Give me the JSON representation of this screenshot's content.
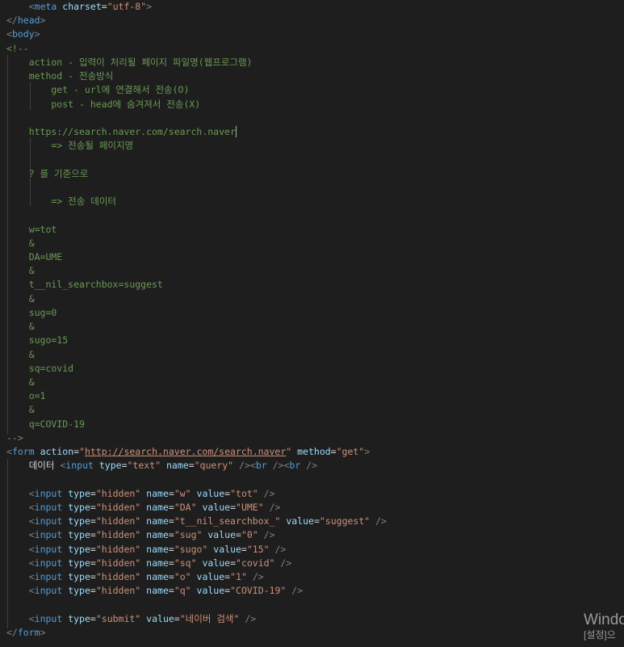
{
  "editor": {
    "language": "html",
    "colors": {
      "background": "#1e1e1e",
      "tag_bracket": "#808080",
      "tag_name": "#569cd6",
      "attribute": "#9cdcfe",
      "string": "#ce9178",
      "comment": "#6a9955",
      "text": "#d4d4d4"
    },
    "lines": [
      [
        {
          "t": "    "
        },
        {
          "c": "tag",
          "t": "<"
        },
        {
          "c": "tname",
          "t": "meta"
        },
        {
          "t": " "
        },
        {
          "c": "attr",
          "t": "charset"
        },
        {
          "t": "="
        },
        {
          "c": "str",
          "t": "\"utf-8\""
        },
        {
          "c": "tag",
          "t": ">"
        }
      ],
      [
        {
          "c": "tag",
          "t": "</"
        },
        {
          "c": "tname",
          "t": "head"
        },
        {
          "c": "tag",
          "t": ">"
        }
      ],
      [
        {
          "c": "tag",
          "t": "<"
        },
        {
          "c": "tname",
          "t": "body"
        },
        {
          "c": "tag",
          "t": ">"
        }
      ],
      [
        {
          "c": "cmt",
          "t": "<!--"
        }
      ],
      [
        {
          "c": "cmt",
          "t": "    action - 입력이 처리될 페이지 파일명(웹프로그램)"
        }
      ],
      [
        {
          "c": "cmt",
          "t": "    method - 전송방식"
        }
      ],
      [
        {
          "c": "cmt",
          "t": "        get - url에 연결해서 전송(O)"
        }
      ],
      [
        {
          "c": "cmt",
          "t": "        post - head에 숨겨져서 전송(X)"
        }
      ],
      [
        {
          "c": "cmt",
          "t": ""
        }
      ],
      [
        {
          "c": "cmt",
          "t": "    https://search.naver.com/search.naver"
        },
        {
          "cursor": true
        }
      ],
      [
        {
          "c": "cmt",
          "t": "        => 전송될 페이지명"
        }
      ],
      [
        {
          "c": "cmt",
          "t": ""
        }
      ],
      [
        {
          "c": "cmt",
          "t": "    ? 를 기준으로"
        }
      ],
      [
        {
          "c": "cmt",
          "t": ""
        }
      ],
      [
        {
          "c": "cmt",
          "t": "        => 전송 데이터"
        }
      ],
      [
        {
          "c": "cmt",
          "t": ""
        }
      ],
      [
        {
          "c": "cmt",
          "t": "    w=tot"
        }
      ],
      [
        {
          "c": "cmt",
          "t": "    &"
        }
      ],
      [
        {
          "c": "cmt",
          "t": "    DA=UME"
        }
      ],
      [
        {
          "c": "cmt",
          "t": "    &"
        }
      ],
      [
        {
          "c": "cmt",
          "t": "    t__nil_searchbox=suggest"
        }
      ],
      [
        {
          "c": "cmt",
          "t": "    &"
        }
      ],
      [
        {
          "c": "cmt",
          "t": "    sug=0"
        }
      ],
      [
        {
          "c": "cmt",
          "t": "    &"
        }
      ],
      [
        {
          "c": "cmt",
          "t": "    sugo=15"
        }
      ],
      [
        {
          "c": "cmt",
          "t": "    &"
        }
      ],
      [
        {
          "c": "cmt",
          "t": "    sq=covid"
        }
      ],
      [
        {
          "c": "cmt",
          "t": "    &"
        }
      ],
      [
        {
          "c": "cmt",
          "t": "    o=1"
        }
      ],
      [
        {
          "c": "cmt",
          "t": "    &"
        }
      ],
      [
        {
          "c": "cmt",
          "t": "    q=COVID-19"
        }
      ],
      [
        {
          "c": "cmt",
          "t": "-->"
        }
      ],
      [
        {
          "c": "tag",
          "t": "<"
        },
        {
          "c": "tname",
          "t": "form"
        },
        {
          "t": " "
        },
        {
          "c": "attr",
          "t": "action"
        },
        {
          "t": "="
        },
        {
          "c": "str",
          "t": "\""
        },
        {
          "c": "str url",
          "t": "http://search.naver.com/search.naver"
        },
        {
          "c": "str",
          "t": "\""
        },
        {
          "t": " "
        },
        {
          "c": "attr",
          "t": "method"
        },
        {
          "t": "="
        },
        {
          "c": "str",
          "t": "\"get\""
        },
        {
          "c": "tag",
          "t": ">"
        }
      ],
      [
        {
          "t": "    데이터 "
        },
        {
          "c": "tag",
          "t": "<"
        },
        {
          "c": "tname",
          "t": "input"
        },
        {
          "t": " "
        },
        {
          "c": "attr",
          "t": "type"
        },
        {
          "t": "="
        },
        {
          "c": "str",
          "t": "\"text\""
        },
        {
          "t": " "
        },
        {
          "c": "attr",
          "t": "name"
        },
        {
          "t": "="
        },
        {
          "c": "str",
          "t": "\"query\""
        },
        {
          "t": " "
        },
        {
          "c": "tag",
          "t": "/><"
        },
        {
          "c": "tname",
          "t": "br"
        },
        {
          "t": " "
        },
        {
          "c": "tag",
          "t": "/><"
        },
        {
          "c": "tname",
          "t": "br"
        },
        {
          "t": " "
        },
        {
          "c": "tag",
          "t": "/>"
        }
      ],
      [
        {
          "t": ""
        }
      ],
      [
        {
          "t": "    "
        },
        {
          "c": "tag",
          "t": "<"
        },
        {
          "c": "tname",
          "t": "input"
        },
        {
          "t": " "
        },
        {
          "c": "attr",
          "t": "type"
        },
        {
          "t": "="
        },
        {
          "c": "str",
          "t": "\"hidden\""
        },
        {
          "t": " "
        },
        {
          "c": "attr",
          "t": "name"
        },
        {
          "t": "="
        },
        {
          "c": "str",
          "t": "\"w\""
        },
        {
          "t": " "
        },
        {
          "c": "attr",
          "t": "value"
        },
        {
          "t": "="
        },
        {
          "c": "str",
          "t": "\"tot\""
        },
        {
          "t": " "
        },
        {
          "c": "tag",
          "t": "/>"
        }
      ],
      [
        {
          "t": "    "
        },
        {
          "c": "tag",
          "t": "<"
        },
        {
          "c": "tname",
          "t": "input"
        },
        {
          "t": " "
        },
        {
          "c": "attr",
          "t": "type"
        },
        {
          "t": "="
        },
        {
          "c": "str",
          "t": "\"hidden\""
        },
        {
          "t": " "
        },
        {
          "c": "attr",
          "t": "name"
        },
        {
          "t": "="
        },
        {
          "c": "str",
          "t": "\"DA\""
        },
        {
          "t": " "
        },
        {
          "c": "attr",
          "t": "value"
        },
        {
          "t": "="
        },
        {
          "c": "str",
          "t": "\"UME\""
        },
        {
          "t": " "
        },
        {
          "c": "tag",
          "t": "/>"
        }
      ],
      [
        {
          "t": "    "
        },
        {
          "c": "tag",
          "t": "<"
        },
        {
          "c": "tname",
          "t": "input"
        },
        {
          "t": " "
        },
        {
          "c": "attr",
          "t": "type"
        },
        {
          "t": "="
        },
        {
          "c": "str",
          "t": "\"hidden\""
        },
        {
          "t": " "
        },
        {
          "c": "attr",
          "t": "name"
        },
        {
          "t": "="
        },
        {
          "c": "str",
          "t": "\"t__nil_searchbox_\""
        },
        {
          "t": " "
        },
        {
          "c": "attr",
          "t": "value"
        },
        {
          "t": "="
        },
        {
          "c": "str",
          "t": "\"suggest\""
        },
        {
          "t": " "
        },
        {
          "c": "tag",
          "t": "/>"
        }
      ],
      [
        {
          "t": "    "
        },
        {
          "c": "tag",
          "t": "<"
        },
        {
          "c": "tname",
          "t": "input"
        },
        {
          "t": " "
        },
        {
          "c": "attr",
          "t": "type"
        },
        {
          "t": "="
        },
        {
          "c": "str",
          "t": "\"hidden\""
        },
        {
          "t": " "
        },
        {
          "c": "attr",
          "t": "name"
        },
        {
          "t": "="
        },
        {
          "c": "str",
          "t": "\"sug\""
        },
        {
          "t": " "
        },
        {
          "c": "attr",
          "t": "value"
        },
        {
          "t": "="
        },
        {
          "c": "str",
          "t": "\"0\""
        },
        {
          "t": " "
        },
        {
          "c": "tag",
          "t": "/>"
        }
      ],
      [
        {
          "t": "    "
        },
        {
          "c": "tag",
          "t": "<"
        },
        {
          "c": "tname",
          "t": "input"
        },
        {
          "t": " "
        },
        {
          "c": "attr",
          "t": "type"
        },
        {
          "t": "="
        },
        {
          "c": "str",
          "t": "\"hidden\""
        },
        {
          "t": " "
        },
        {
          "c": "attr",
          "t": "name"
        },
        {
          "t": "="
        },
        {
          "c": "str",
          "t": "\"sugo\""
        },
        {
          "t": " "
        },
        {
          "c": "attr",
          "t": "value"
        },
        {
          "t": "="
        },
        {
          "c": "str",
          "t": "\"15\""
        },
        {
          "t": " "
        },
        {
          "c": "tag",
          "t": "/>"
        }
      ],
      [
        {
          "t": "    "
        },
        {
          "c": "tag",
          "t": "<"
        },
        {
          "c": "tname",
          "t": "input"
        },
        {
          "t": " "
        },
        {
          "c": "attr",
          "t": "type"
        },
        {
          "t": "="
        },
        {
          "c": "str",
          "t": "\"hidden\""
        },
        {
          "t": " "
        },
        {
          "c": "attr",
          "t": "name"
        },
        {
          "t": "="
        },
        {
          "c": "str",
          "t": "\"sq\""
        },
        {
          "t": " "
        },
        {
          "c": "attr",
          "t": "value"
        },
        {
          "t": "="
        },
        {
          "c": "str",
          "t": "\"covid\""
        },
        {
          "t": " "
        },
        {
          "c": "tag",
          "t": "/>"
        }
      ],
      [
        {
          "t": "    "
        },
        {
          "c": "tag",
          "t": "<"
        },
        {
          "c": "tname",
          "t": "input"
        },
        {
          "t": " "
        },
        {
          "c": "attr",
          "t": "type"
        },
        {
          "t": "="
        },
        {
          "c": "str",
          "t": "\"hidden\""
        },
        {
          "t": " "
        },
        {
          "c": "attr",
          "t": "name"
        },
        {
          "t": "="
        },
        {
          "c": "str",
          "t": "\"o\""
        },
        {
          "t": " "
        },
        {
          "c": "attr",
          "t": "value"
        },
        {
          "t": "="
        },
        {
          "c": "str",
          "t": "\"1\""
        },
        {
          "t": " "
        },
        {
          "c": "tag",
          "t": "/>"
        }
      ],
      [
        {
          "t": "    "
        },
        {
          "c": "tag",
          "t": "<"
        },
        {
          "c": "tname",
          "t": "input"
        },
        {
          "t": " "
        },
        {
          "c": "attr",
          "t": "type"
        },
        {
          "t": "="
        },
        {
          "c": "str",
          "t": "\"hidden\""
        },
        {
          "t": " "
        },
        {
          "c": "attr",
          "t": "name"
        },
        {
          "t": "="
        },
        {
          "c": "str",
          "t": "\"q\""
        },
        {
          "t": " "
        },
        {
          "c": "attr",
          "t": "value"
        },
        {
          "t": "="
        },
        {
          "c": "str",
          "t": "\"COVID-19\""
        },
        {
          "t": " "
        },
        {
          "c": "tag",
          "t": "/>"
        }
      ],
      [
        {
          "t": ""
        }
      ],
      [
        {
          "t": "    "
        },
        {
          "c": "tag",
          "t": "<"
        },
        {
          "c": "tname",
          "t": "input"
        },
        {
          "t": " "
        },
        {
          "c": "attr",
          "t": "type"
        },
        {
          "t": "="
        },
        {
          "c": "str",
          "t": "\"submit\""
        },
        {
          "t": " "
        },
        {
          "c": "attr",
          "t": "value"
        },
        {
          "t": "="
        },
        {
          "c": "str",
          "t": "\"네이버 검색\""
        },
        {
          "t": " "
        },
        {
          "c": "tag",
          "t": "/>"
        }
      ],
      [
        {
          "c": "tag",
          "t": "</"
        },
        {
          "c": "tname",
          "t": "form"
        },
        {
          "c": "tag",
          "t": ">"
        }
      ]
    ]
  },
  "watermark": {
    "line1": "Windo",
    "line2": "[설정]으"
  }
}
